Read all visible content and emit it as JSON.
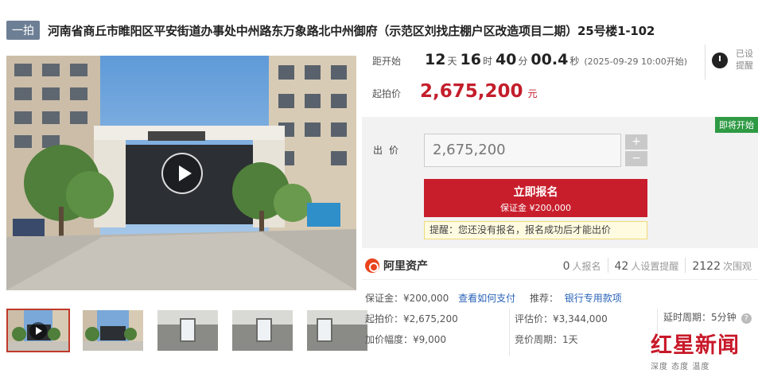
{
  "header": {
    "badge": "一拍",
    "title": "河南省商丘市睢阳区平安街道办事处中州路东万象路北中州御府（示范区刘找庄棚户区改造项目二期）25号楼1-102"
  },
  "countdown": {
    "label": "距开始",
    "days": "12",
    "days_unit": "天",
    "hours": "16",
    "hours_unit": "时",
    "minutes": "40",
    "minutes_unit": "分",
    "seconds": "00.4",
    "seconds_unit": "秒",
    "start_note": "(2025-09-29 10:00开始)"
  },
  "reminder": {
    "label": "已设提醒",
    "icon": "alarm-clock-icon"
  },
  "start_price": {
    "label": "起拍价",
    "value": "2,675,200",
    "unit": "元"
  },
  "bid": {
    "status_tag": "即将开始",
    "label": "出价",
    "value": "2,675,200",
    "plus": "+",
    "minus": "−",
    "signup_label": "立即报名",
    "deposit_label": "保证金 ¥200,000",
    "tip": "提醒：您还没有报名，报名成功后才能出价"
  },
  "platform": {
    "name": "阿里资产",
    "stats": [
      {
        "num": "0",
        "text": "人报名"
      },
      {
        "num": "42",
        "text": "人设置提醒"
      },
      {
        "num": "2122",
        "text": "次围观"
      }
    ]
  },
  "details": {
    "deposit": "保证金：¥200,000",
    "how_to_pay": "查看如何支付",
    "recommend_label": "推荐：",
    "recommend_link": "银行专用款项",
    "start_price": "起拍价：¥2,675,200",
    "appraisal": "评估价：¥3,344,000",
    "delay_period": "延时周期：5分钟",
    "increment": "加价幅度：¥9,000",
    "bid_period": "竞价周期：1天"
  },
  "watermark": {
    "main": "红星新闻",
    "sub": "深度 态度 温度"
  },
  "colors": {
    "accent": "#c81e2c",
    "status_green": "#2e9a44",
    "link": "#2a62b8"
  }
}
